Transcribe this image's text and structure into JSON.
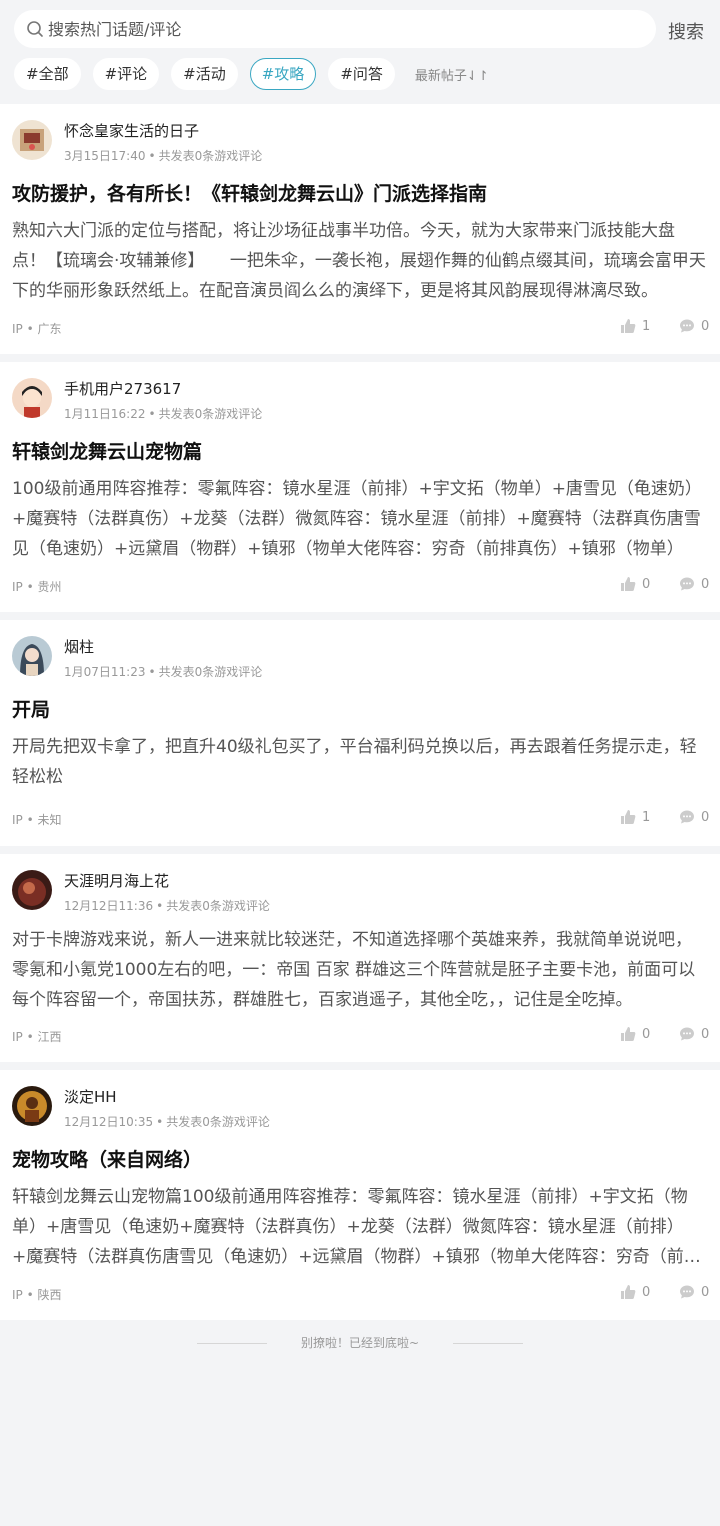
{
  "search": {
    "placeholder": "搜索热门话题/评论",
    "button": "搜索"
  },
  "tags": [
    "#全部",
    "#评论",
    "#活动",
    "#攻略",
    "#问答"
  ],
  "active_tag": "#攻略",
  "sort_label": "最新帖子⇃↾",
  "posts": [
    {
      "username": "怀念皇家生活的日子",
      "date": "3月15日17:40",
      "stats": "共发表0条游戏评论",
      "title": "攻防援护，各有所长！《轩辕剑龙舞云山》门派选择指南",
      "body": "熟知六大门派的定位与搭配，将让沙场征战事半功倍。今天，就为大家带来门派技能大盘点！【琉璃会·攻辅兼修】　　一把朱伞，一袭长袍，展翅作舞的仙鹤点缀其间，琉璃会富甲天下的华丽形象跃然纸上。在配音演员阎么么的演绎下，更是将其风韵展现得淋漓尽致。",
      "ip": "IP • 广东",
      "likes": "1",
      "comments": "0",
      "avatar_color": "#c8a27a"
    },
    {
      "username": "手机用户273617",
      "date": "1月11日16:22",
      "stats": "共发表0条游戏评论",
      "title": "轩辕剑龙舞云山宠物篇",
      "body": "100级前通用阵容推荐：零氟阵容：镜水星涯（前排）+宇文拓（物单）+唐雪见（龟速奶）+魔赛特（法群真伤）+龙葵（法群）微氮阵容：镜水星涯（前排）+魔赛特（法群真伤唐雪见（龟速奶）+远黛眉（物群）+镇邪（物单大佬阵容：穷奇（前排真伤）+镇邪（物单）",
      "ip": "IP • 贵州",
      "likes": "0",
      "comments": "0",
      "avatar_color": "#f4d9c6"
    },
    {
      "username": "烟柱",
      "date": "1月07日11:23",
      "stats": "共发表0条游戏评论",
      "title": "开局",
      "body": "开局先把双卡拿了，把直升40级礼包买了，平台福利码兑换以后，再去跟着任务提示走，轻轻松松",
      "ip": "IP • 未知",
      "likes": "1",
      "comments": "0",
      "avatar_color": "#8fa9b8"
    },
    {
      "username": "天涯明月海上花",
      "date": "12月12日11:36",
      "stats": "共发表0条游戏评论",
      "title": "",
      "body": "对于卡牌游戏来说，新人一进来就比较迷茫，不知道选择哪个英雄来养，我就简单说说吧，零氪和小氪党1000左右的吧，一：帝国 百家 群雄这三个阵营就是胚子主要卡池，前面可以每个阵容留一个，帝国扶苏，群雄胜七，百家逍遥子，其他全吃，，记住是全吃掉。",
      "ip": "IP • 江西",
      "likes": "0",
      "comments": "0",
      "avatar_color": "#7a2e24"
    },
    {
      "username": "淡定HH",
      "date": "12月12日10:35",
      "stats": "共发表0条游戏评论",
      "title": "宠物攻略（来自网络）",
      "body": "轩辕剑龙舞云山宠物篇100级前通用阵容推荐：零氟阵容：镜水星涯（前排）+宇文拓（物单）+唐雪见（龟速奶+魔赛特（法群真伤）+龙葵（法群）微氮阵容：镜水星涯（前排）+魔赛特（法群真伤唐雪见（龟速奶）+远黛眉（物群）+镇邪（物单大佬阵容：穷奇（前排）",
      "ip": "IP • 陕西",
      "likes": "0",
      "comments": "0",
      "avatar_color": "#c98a2a"
    }
  ],
  "footer_text": "别撩啦！已经到底啦~"
}
